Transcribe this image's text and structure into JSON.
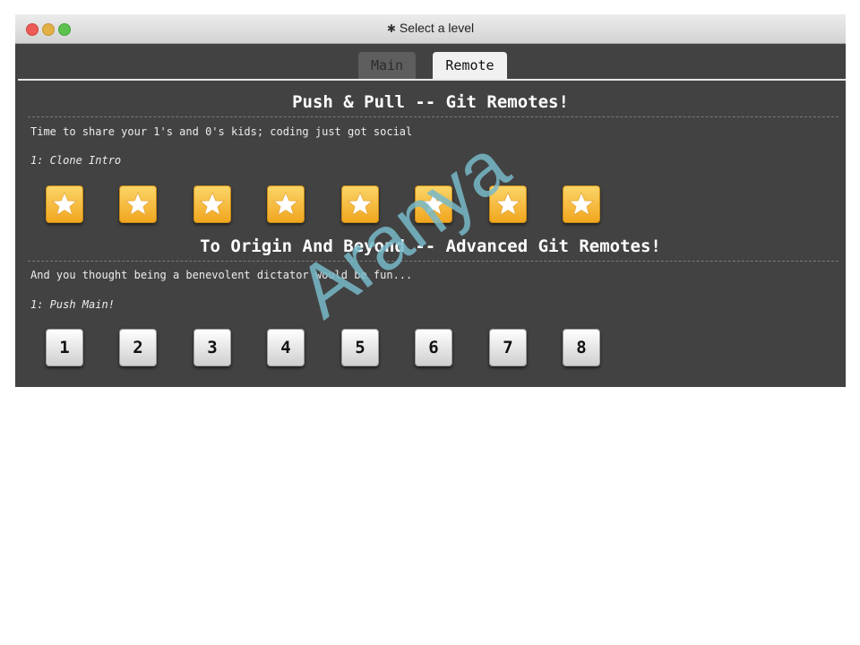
{
  "window": {
    "title": "Select a level",
    "title_icon": "gear-icon",
    "traffic_lights": [
      "close",
      "minimize",
      "maximize"
    ]
  },
  "tabs": [
    {
      "label": "Main",
      "active": false
    },
    {
      "label": "Remote",
      "active": true
    }
  ],
  "sections": [
    {
      "title": "Push & Pull -- Git Remotes!",
      "description": "Time to share your 1's and 0's kids; coding just got social",
      "selected_level": "1: Clone Intro",
      "level_buttons": [
        "star-icon",
        "star-icon",
        "star-icon",
        "star-icon",
        "star-icon",
        "star-icon",
        "star-icon",
        "star-icon"
      ]
    },
    {
      "title": "To Origin And Beyond -- Advanced Git Remotes!",
      "description": "And you thought being a benevolent dictator would be fun...",
      "selected_level": "1: Push Main!",
      "level_buttons": [
        "1",
        "2",
        "3",
        "4",
        "5",
        "6",
        "7",
        "8"
      ]
    }
  ],
  "watermark": "Aranya",
  "colors": {
    "window_bg": "#424242",
    "star_button": "#f4b431",
    "number_button": "#e8e8e8",
    "active_tab": "#f1f1f1",
    "inactive_tab": "#5e5e5e"
  }
}
